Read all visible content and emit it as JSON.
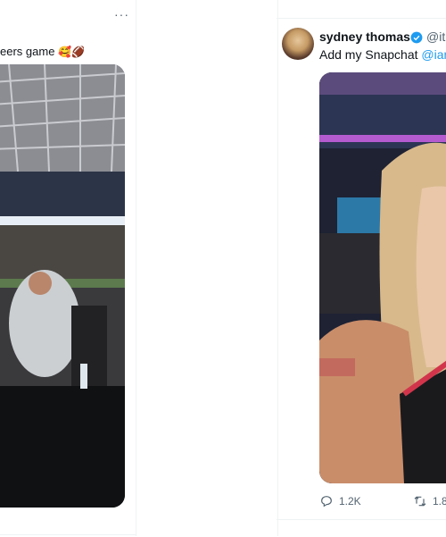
{
  "left_tweet": {
    "text": "eers game",
    "emojis": "🥰🏈",
    "more_label": "···"
  },
  "right_tweet": {
    "name": "sydney thomas",
    "handle": "@it",
    "text_prefix": "Add my Snapchat ",
    "mention": "@iam",
    "replies": "1.2K",
    "reposts": "1.8"
  },
  "colors": {
    "link": "#1d9bf0",
    "muted": "#536471",
    "verified": "#1d9bf0"
  }
}
